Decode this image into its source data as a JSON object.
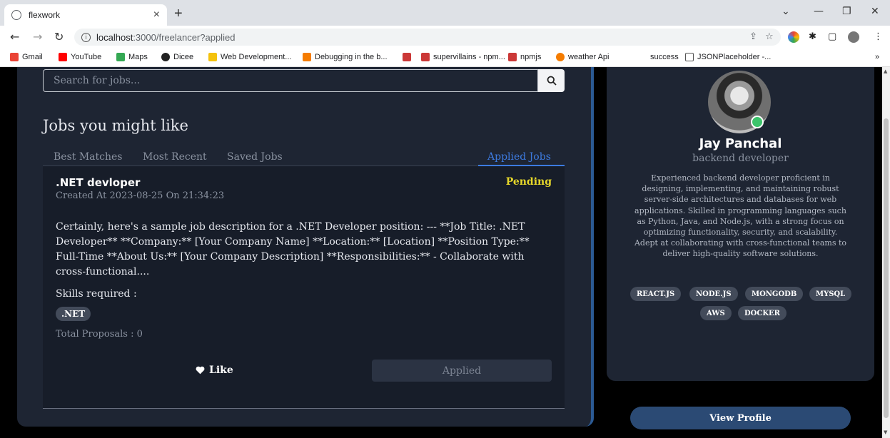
{
  "browser": {
    "tab_title": "flexwork",
    "tab_close": "×",
    "new_tab": "+",
    "url_host": "localhost",
    "url_rest": ":3000/freelancer?applied",
    "bookmarks": [
      "Gmail",
      "YouTube",
      "Maps",
      "Dicee",
      "Web Development...",
      "Debugging in the b...",
      "supervillains - npm...",
      "npmjs",
      "weather Api",
      "success",
      "JSONPlaceholder -..."
    ],
    "bookmarks_more": "»"
  },
  "search": {
    "placeholder": "Search for jobs..."
  },
  "jobs_section": {
    "title": "Jobs you might like",
    "tabs": [
      "Best Matches",
      "Most Recent",
      "Saved Jobs",
      "Applied Jobs"
    ],
    "active_tab": "Applied Jobs"
  },
  "job": {
    "title": ".NET devloper",
    "status": "Pending",
    "status_color": "#e6d72a",
    "created": "Created At 2023-08-25 On 21:34:23",
    "description": "Certainly, here's a sample job description for a .NET Developer position: --- **Job Title: .NET Developer** **Company:** [Your Company Name] **Location:** [Location] **Position Type:** Full-Time **About Us:** [Your Company Description] **Responsibilities:** - Collaborate with cross-functional....",
    "skills_label": "Skills required :",
    "skills": [
      ".NET"
    ],
    "proposals": "Total Proposals : 0",
    "like_label": "Like",
    "applied_label": "Applied"
  },
  "profile": {
    "name": "Jay Panchal",
    "role": "backend developer",
    "bio": "Experienced backend developer proficient in designing, implementing, and maintaining robust server-side architectures and databases for web applications. Skilled in programming languages such as Python, Java, and Node.js, with a strong focus on optimizing functionality, security, and scalability. Adept at collaborating with cross-functional teams to deliver high-quality software solutions.",
    "skills": [
      "REACT.JS",
      "NODE.JS",
      "MONGODB",
      "MYSQL",
      "AWS",
      "DOCKER"
    ],
    "view_profile_label": "View Profile",
    "online_color": "#3cc46b"
  },
  "colors": {
    "accent": "#3d7be0",
    "card_bg": "#1e2533",
    "button_blue": "#2b4a74"
  }
}
